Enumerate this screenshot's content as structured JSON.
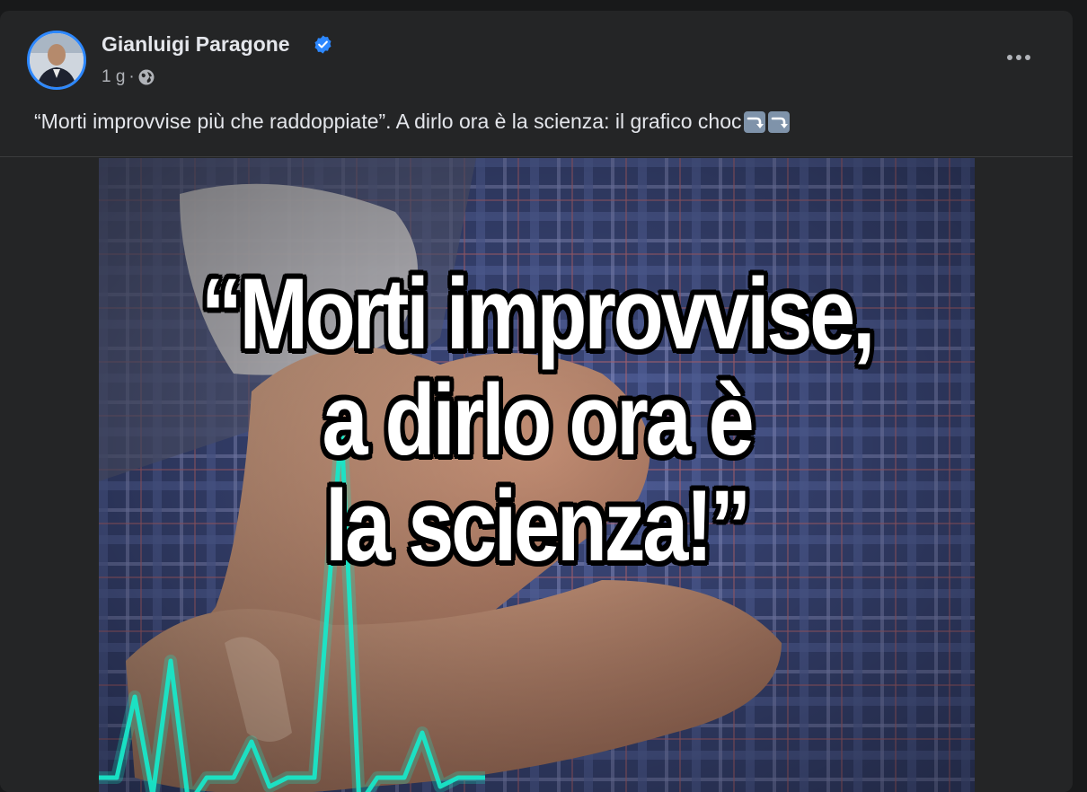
{
  "post": {
    "author": "Gianluigi Paragone",
    "time": "1 g",
    "separator": "·",
    "caption": "“Morti improvvise più che raddoppiate”. A dirlo ora è la scienza: il grafico choc"
  },
  "icons": {
    "verified": "verified-badge-icon",
    "audience": "globe-icon",
    "more": "more-options-icon",
    "caption_emoji": "arrow-right-curving-down-emoji"
  },
  "media": {
    "overlay_lines": [
      "“Morti improvvise,",
      "a dirlo ora è",
      "la scienza!”"
    ]
  },
  "colors": {
    "background": "#18191a",
    "card": "#242526",
    "primary_text": "#e4e6eb",
    "secondary_text": "#b0b3b8",
    "accent": "#2d88ff",
    "ecg_line": "#19e6c8"
  }
}
